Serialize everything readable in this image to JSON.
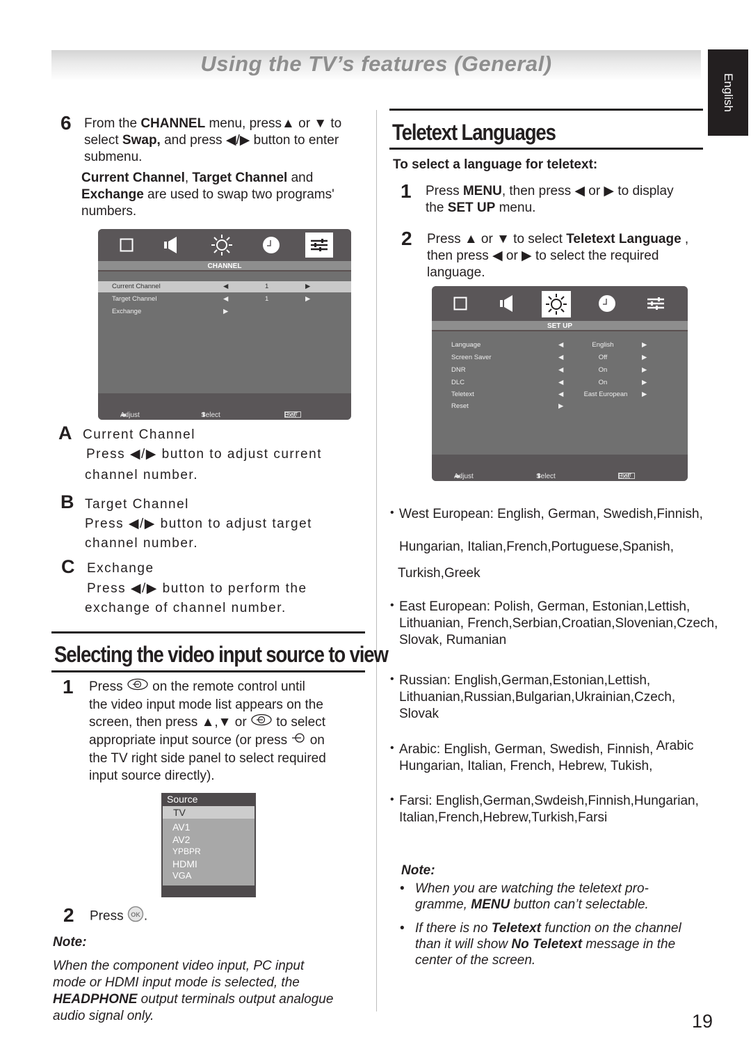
{
  "header": {
    "title": "Using the TV’s features (General)",
    "language_tab": "English"
  },
  "left": {
    "step6": {
      "number": "6",
      "line1_a": "From the ",
      "line1_b": "CHANNEL",
      "line1_c": " menu, press",
      "line1_d": " or ",
      "line1_e": " to",
      "line2_a": "select ",
      "line2_b": "Swap,",
      "line2_c": " and press ",
      "line2_d": " button  to enter",
      "line3": "submenu.",
      "para_a": "Current Channel",
      "para_b": ", ",
      "para_c": "Target Channel",
      "para_d": " and",
      "para_e": "Exchange",
      "para_f": " are used to swap two programs'",
      "para_g": "numbers."
    },
    "channel_menu": {
      "title": "CHANNEL",
      "icons": [
        "picture-icon",
        "sound-icon",
        "setup-icon",
        "clock-icon",
        "channel-icon"
      ],
      "active_icon": "channel-icon",
      "rows": [
        {
          "label": "Current Channel",
          "value": "1",
          "highlighted": true
        },
        {
          "label": "Target Channel",
          "value": "1",
          "highlighted": false
        },
        {
          "label": "Exchange",
          "value": "",
          "highlighted": false
        }
      ],
      "footer": {
        "adjust": "Adjust",
        "select": "Select",
        "exit_key": "EXIT",
        "exit": "Exit"
      }
    },
    "items": [
      {
        "letter": "A",
        "title": "Current Channel",
        "line1": "Press ◀/▶  button to adjust current",
        "line2": "channel number."
      },
      {
        "letter": "B",
        "title": "Target Channel",
        "line1": "Press ◀/▶  button to adjust target",
        "line2": "channel number."
      },
      {
        "letter": "C",
        "title": "Exchange",
        "line1": "Press ◀/▶ button to perform the",
        "line2": "exchange of channel number."
      }
    ],
    "video_section": {
      "title": "Selecting the video input source to view",
      "step1": {
        "number": "1",
        "l1a": "Press ",
        "l1b": " on the remote control until",
        "l2": "the video input mode list appears on the",
        "l3a": "screen, then press ▲,▼ or ",
        "l3b": " to select",
        "l4a": "appropriate input source (or press ",
        "l4b": " on",
        "l5": "the TV right side panel to select required",
        "l6": "input source directly)."
      },
      "source_list": {
        "header": "Source",
        "selected": "TV",
        "items": [
          "AV1",
          "AV2",
          "YPBPR",
          "HDMI",
          "VGA"
        ]
      },
      "step2": {
        "number": "2",
        "text_a": "Press ",
        "text_b": "."
      },
      "note_label": "Note:",
      "note_l1": "When the component video input, PC input",
      "note_l2": "mode or HDMI input mode is selected, the",
      "note_l3a": "HEADPHONE",
      "note_l3b": " output terminals output analogue",
      "note_l4": "audio signal only."
    }
  },
  "right": {
    "title": "Teletext Languages",
    "subtitle": "To select a language for teletext:",
    "step1": {
      "number": "1",
      "l1a": "Press ",
      "l1b": "MENU",
      "l1c": ", then press ◀ or ▶ to display",
      "l2a": "the ",
      "l2b": "SET UP",
      "l2c": " menu."
    },
    "step2": {
      "number": "2",
      "l1a": "Press ▲ or ▼ to select ",
      "l1b": "Teletext Language",
      "l1c": " ,",
      "l2": " then press ◀ or ▶ to select the required",
      "l3": " language."
    },
    "setup_menu": {
      "title": "SET UP",
      "icons": [
        "picture-icon",
        "sound-icon",
        "setup-icon",
        "clock-icon",
        "channel-icon"
      ],
      "active_icon": "setup-icon",
      "rows": [
        {
          "label": "Language",
          "value": "English"
        },
        {
          "label": "Screen Saver",
          "value": "Off"
        },
        {
          "label": "DNR",
          "value": "On"
        },
        {
          "label": "DLC",
          "value": "On"
        },
        {
          "label": "Teletext",
          "value": "East European"
        },
        {
          "label": "Reset",
          "value": ""
        }
      ],
      "footer": {
        "adjust": "Adjust",
        "select": "Select",
        "exit_key": "EXIT",
        "exit": "Exit"
      }
    },
    "languages": [
      {
        "lines": [
          "West European: English, German, Swedish,Finnish,",
          "Hungarian, Italian,French,Portuguese,Spanish,",
          "Turkish,Greek"
        ]
      },
      {
        "lines": [
          "East European: Polish, German, Estonian,Lettish,",
          "Lithuanian, French,Serbian,Croatian,Slovenian,Czech,",
          "Slovak, Rumanian"
        ]
      },
      {
        "lines": [
          "Russian: English,German,Estonian,Lettish,",
          "Lithuanian,Russian,Bulgarian,Ukrainian,Czech,",
          "Slovak"
        ]
      },
      {
        "lines": [
          "Arabic: English, German, Swedish, Finnish,",
          "Hungarian, Italian, French, Hebrew, Tukish,"
        ],
        "extra": "Arabic"
      },
      {
        "lines": [
          "Farsi: English,German,Swdeish,Finnish,Hungarian,",
          "Italian,French,Hebrew,Turkish,Farsi"
        ]
      }
    ],
    "note": {
      "label": "Note:",
      "b1_l1": "When you are watching the teletext pro-",
      "b1_l2a": "gramme, ",
      "b1_l2b": "MENU",
      "b1_l2c": " button can’t selectable.",
      "b2_l1a": "If there is no ",
      "b2_l1b": "Teletext",
      "b2_l1c": " function on the channel",
      "b2_l2a": "than it will show ",
      "b2_l2b": "No Teletext",
      "b2_l2c": " message in the",
      "b2_l3": "center of the screen."
    }
  },
  "page_number": "19"
}
